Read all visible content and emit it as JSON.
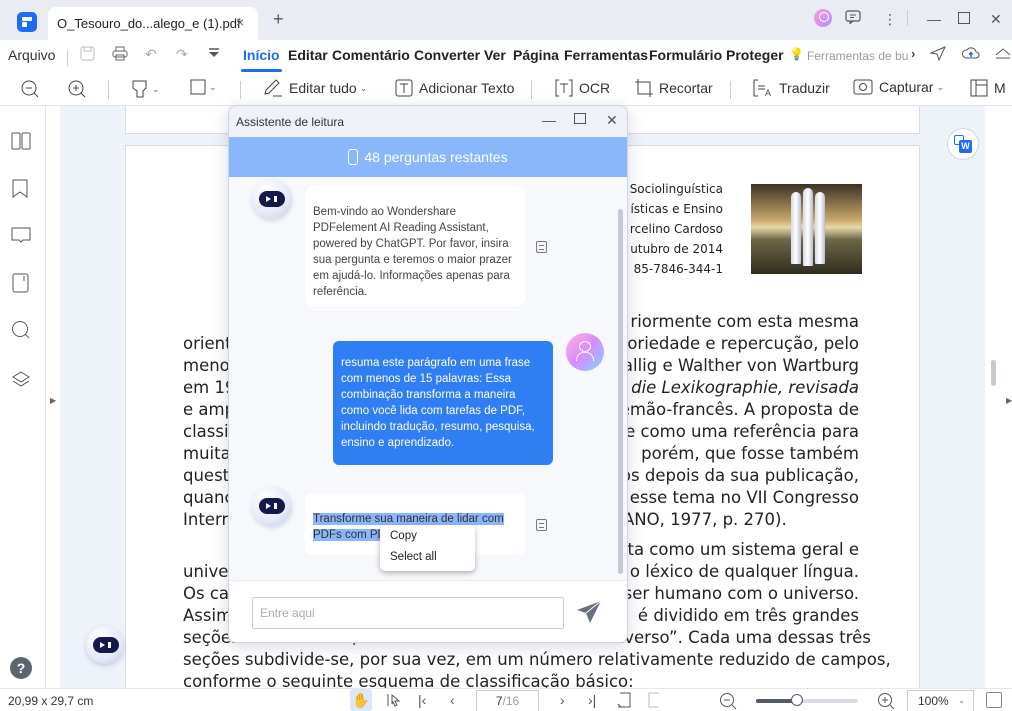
{
  "titlebar": {
    "tab_title": "O_Tesouro_do...alego_e (1).pdf",
    "close_glyph": "×",
    "add_glyph": "+"
  },
  "menubar": {
    "file_label": "Arquivo",
    "items": [
      {
        "label": "Início",
        "active": true
      },
      {
        "label": "Editar"
      },
      {
        "label": "Comentário"
      },
      {
        "label": "Converter"
      },
      {
        "label": "Ver"
      },
      {
        "label": "Página"
      },
      {
        "label": "Ferramentas"
      },
      {
        "label": "Formulário"
      },
      {
        "label": "Proteger"
      }
    ],
    "search_hint": "Ferramentas de bu",
    "search_hint_more": "›"
  },
  "toolbar": {
    "edit_all": "Editar tudo",
    "add_text": "Adicionar Texto",
    "ocr": "OCR",
    "crop": "Recortar",
    "translate": "Traduzir",
    "capture": "Capturar",
    "more": "M"
  },
  "document": {
    "header_lines": [
      "Sociolinguística",
      "ísticas e Ensino",
      "rcelino Cardoso",
      "utubro de 2014",
      "85-7846-344-1"
    ],
    "left_lines": [
      "orient",
      "meno",
      "em 19",
      "e amp",
      "classi",
      "muita",
      "quest",
      "quanc",
      "Interr",
      "",
      "unive",
      "Os ca",
      "Assim",
      "seções",
      "seções subdivide-se, por sua vez, em um número relativamente reduzido de campos,",
      "conforme o seguinte esquema de classificação básico:"
    ],
    "right_lines": [
      "riormente com esta mesma",
      "otoriedade e repercução, pelo",
      "Hallig e Walther von Wartburg",
      "für die Lexikographie, revisada",
      "lemão-francês. A proposta de",
      "se como uma referência para",
      "porém, que fosse também",
      "os depois da sua publicação,",
      "re esse tema no VII Congresso",
      "ANO, 1977, p. 270).",
      "enta como um sistema geral e",
      "r o léxico de qualquer língua.",
      "ser humano com o universo.",
      "é dividido em três grandes",
      "verso”. Cada uma dessas três"
    ],
    "line_seções_overlap": "seções: “o universo”, “o homem” e “o homem e o universo”. Cada uma dessas três"
  },
  "assistant": {
    "title": "Assistente de leitura",
    "remaining": "48 perguntas restantes",
    "messages": [
      {
        "role": "bot",
        "text": "Bem-vindo ao Wondershare PDFelement AI Reading Assistant, powered by ChatGPT. Por favor, insira sua pergunta e teremos o maior prazer em ajudá-lo. Informações apenas para referência."
      },
      {
        "role": "user",
        "text": "resuma este parágrafo em uma frase com menos de 15 palavras: Essa combinação transforma a maneira como você lida com tarefas de PDF, incluindo tradução, resumo, pesquisa, ensino e aprendizado."
      },
      {
        "role": "bot",
        "text_selected_1": "Transforme sua maneira de lidar com",
        "text_selected_2": "PDFs com PDF"
      }
    ],
    "context_menu": [
      "Copy",
      "Select all"
    ],
    "input_placeholder": "Entre aqui",
    "input_value": ""
  },
  "statusbar": {
    "page_size": "20,99 x 29,7 cm",
    "current_page": "7",
    "total_pages": "/16",
    "zoom": "100%",
    "zoom_fraction": 0.4
  },
  "colors": {
    "accent": "#1f6bf2",
    "banner": "#8ab6fb",
    "user_bubble": "#2f7ef3"
  }
}
